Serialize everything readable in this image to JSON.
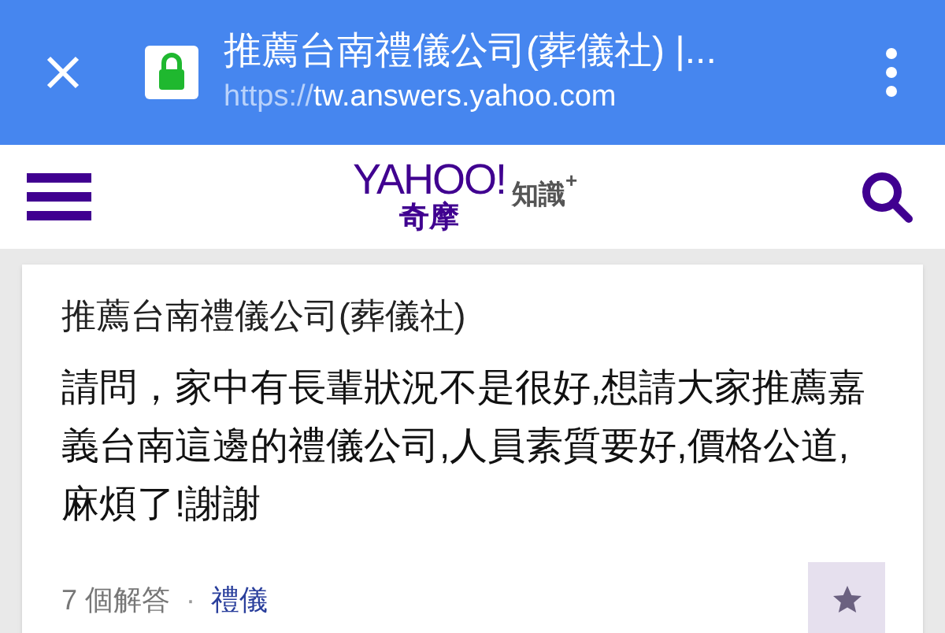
{
  "browser_bar": {
    "page_title": "推薦台南禮儀公司(葬儀社) |...",
    "url_scheme": "https://",
    "url_host": "tw.answers.yahoo.com"
  },
  "site_header": {
    "logo_wordmark": "YAHOO!",
    "logo_subtitle": "奇摩",
    "logo_product": "知識",
    "logo_plus": "+"
  },
  "question": {
    "title": "推薦台南禮儀公司(葬儀社)",
    "body": "請問，家中有長輩狀況不是很好,想請大家推薦嘉義台南這邊的禮儀公司,人員素質要好,價格公道,麻煩了!謝謝",
    "answer_count": "7 個解答",
    "separator": "·",
    "category": "禮儀",
    "starred": false
  }
}
